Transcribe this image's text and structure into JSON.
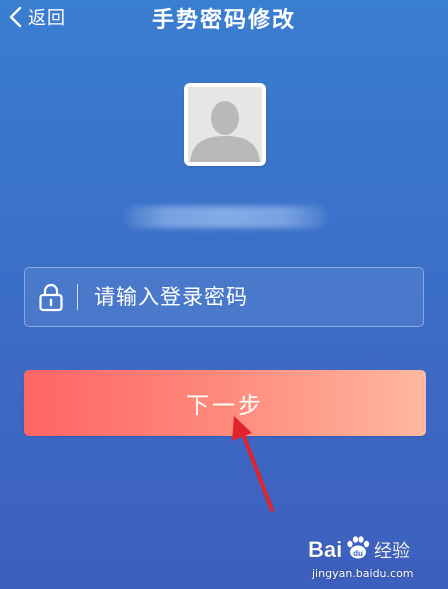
{
  "header": {
    "back_label": "返回",
    "title": "手势密码修改"
  },
  "avatar": {
    "icon": "default-user-avatar-icon"
  },
  "form": {
    "password_placeholder": "请输入登录密码",
    "password_value": "",
    "lock_icon": "lock-icon"
  },
  "actions": {
    "next_label": "下一步"
  },
  "watermark": {
    "brand": "Baidu经验",
    "url": "jingyan.baidu.com"
  },
  "colors": {
    "background_top": "#3a7ed0",
    "background_bottom": "#3d5fbd",
    "button_start": "#ff6565",
    "button_end": "#ffb8a2",
    "annotation_arrow": "#e0242a"
  }
}
